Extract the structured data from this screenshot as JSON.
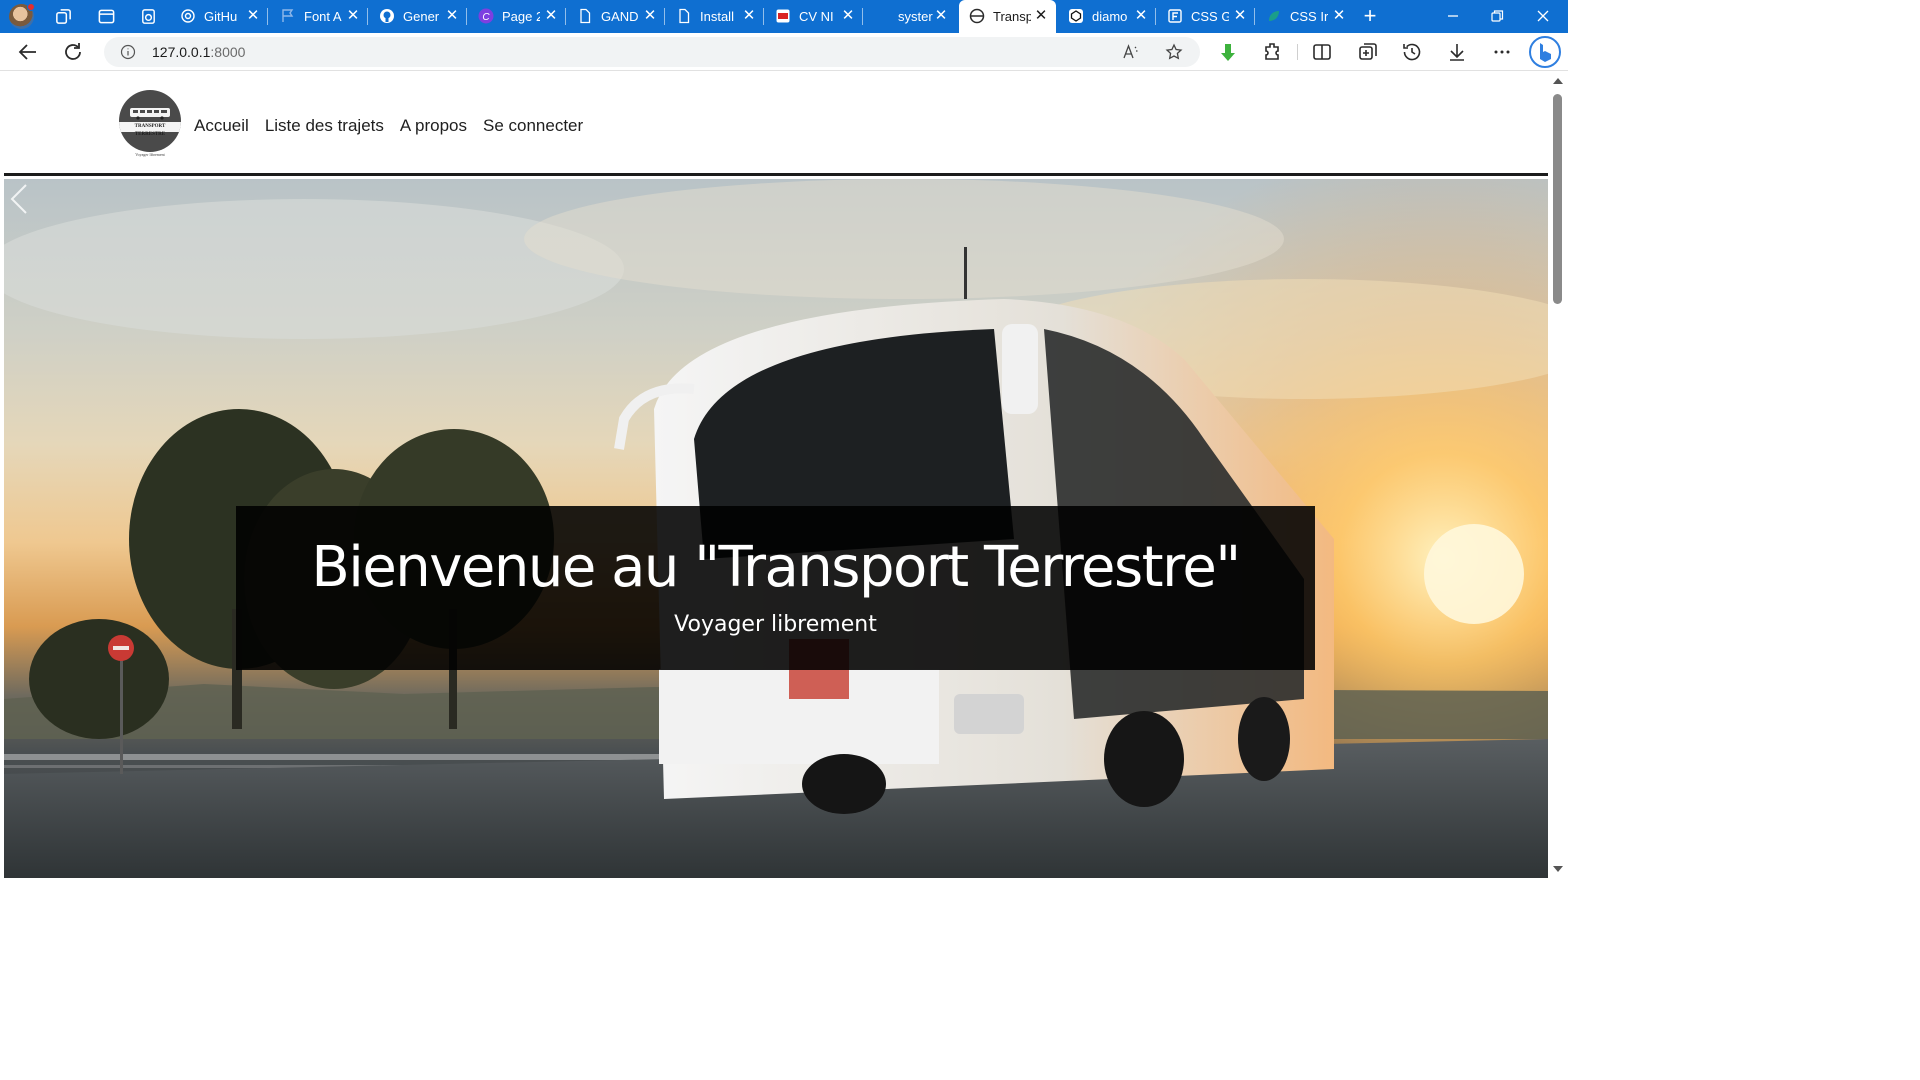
{
  "browser": {
    "tabs": [
      {
        "title": "GitHu",
        "icon": "chatgpt-icon"
      },
      {
        "title": "Font A",
        "icon": "flag-icon"
      },
      {
        "title": "Gener",
        "icon": "github-icon"
      },
      {
        "title": "Page 2",
        "icon": "canva-icon"
      },
      {
        "title": "GAND",
        "icon": "document-icon"
      },
      {
        "title": "Install",
        "icon": "document-icon"
      },
      {
        "title": "CV NI",
        "icon": "pdf-icon"
      },
      {
        "title": "syster",
        "icon": "blank-icon"
      },
      {
        "title": "Transp",
        "icon": "globe-icon",
        "active": true
      },
      {
        "title": "diamo",
        "icon": "codepen-icon"
      },
      {
        "title": "CSS G",
        "icon": "f-icon"
      },
      {
        "title": "CSS Ir",
        "icon": "leaf-icon"
      }
    ],
    "close_glyph": "✕",
    "new_tab_glyph": "+",
    "address": {
      "host": "127.0.0.1",
      "port": ":8000"
    }
  },
  "site": {
    "logo_text": "TRANSPORT TERRESTRE",
    "logo_subtext": "Voyager librement",
    "nav": [
      "Accueil",
      "Liste des trajets",
      "A propos",
      "Se connecter"
    ],
    "hero": {
      "title": "Bienvenue au \"Transport Terrestre\"",
      "subtitle": "Voyager librement"
    }
  },
  "colors": {
    "tabstrip": "#0f6fd1",
    "caption_bg": "#000000",
    "header_border": "#1c1c1c"
  }
}
